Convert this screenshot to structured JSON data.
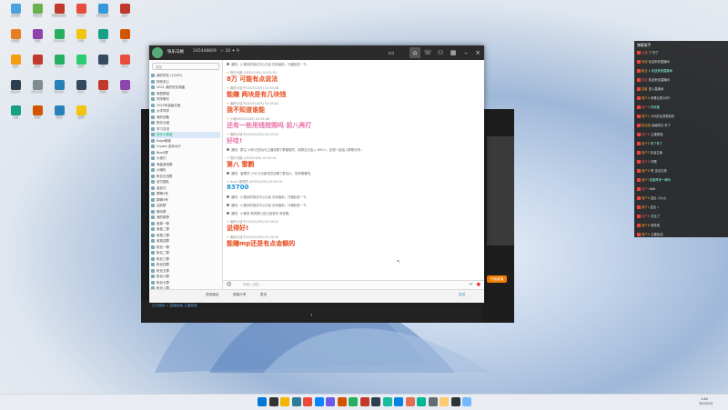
{
  "desktop": {
    "icons": [
      {
        "label": "此电脑",
        "color": "#4aa3df"
      },
      {
        "label": "回收站",
        "color": "#6ab04c"
      },
      {
        "label": "网易云音乐",
        "color": "#c0392b"
      },
      {
        "label": "Edge",
        "color": "#e74c3c"
      },
      {
        "label": "控制面板",
        "color": "#3498db"
      },
      {
        "label": "软件",
        "color": "#c0392b"
      },
      {
        "label": "小程序",
        "color": "#e67e22"
      },
      {
        "label": "文档",
        "color": "#8e44ad"
      },
      {
        "label": "Chrome",
        "color": "#27ae60"
      },
      {
        "label": "OBS",
        "color": "#f1c40f"
      },
      {
        "label": "网易",
        "color": "#16a085"
      },
      {
        "label": "QQ",
        "color": "#d35400"
      },
      {
        "label": "音乐",
        "color": "#f39c12"
      },
      {
        "label": "游戏",
        "color": "#c0392b"
      },
      {
        "label": "Excel",
        "color": "#27ae60"
      },
      {
        "label": "微信",
        "color": "#2ecc71"
      },
      {
        "label": "YY",
        "color": "#34495e"
      },
      {
        "label": "WPS",
        "color": "#e74c3c"
      },
      {
        "label": "Steam",
        "color": "#2c3e50"
      },
      {
        "label": "Blender",
        "color": "#7f8c8d"
      },
      {
        "label": "Steam",
        "color": "#2980b9"
      },
      {
        "label": "Epic",
        "color": "#34495e"
      },
      {
        "label": "网游",
        "color": "#c0392b"
      },
      {
        "label": "视频",
        "color": "#8e44ad"
      },
      {
        "label": "工具",
        "color": "#16a085"
      },
      {
        "label": "剪映",
        "color": "#d35400"
      },
      {
        "label": "腾讯",
        "color": "#2980b9"
      },
      {
        "label": "酷狗",
        "color": "#f1c40f"
      }
    ]
  },
  "qq": {
    "username": "快乐马格",
    "uid": "245448809",
    "status": "☆ 20 ✦ 9",
    "search_placeholder": "搜索",
    "contacts": [
      "我的好友 (22/90)",
      "特别关心",
      "2021 我的好友收藏",
      "家庭群组",
      "同学聊天",
      "2022年高级分组",
      "大学同学",
      "我的设备",
      "阳光大团",
      "学习交流",
      "快乐小群组",
      "Edge频道",
      "Crypto 游戏大厅",
      "BooG群",
      "大佬们",
      "海量游戏群",
      "小喇叭",
      "粉丝交流群",
      "官方团队",
      "朋友们",
      "群聊4号",
      "群聊5号",
      "活跃群",
      "聊天群",
      "我的推荐",
      "家族一群",
      "家族二群",
      "家族三群",
      "家族四群",
      "粉丝一群",
      "粉丝二群",
      "粉丝三群",
      "粉丝四群",
      "粉丝五群",
      "粉丝六群",
      "粉丝七群",
      "粉丝八群",
      "粉丝九群"
    ],
    "messages": [
      {
        "kind": "sys",
        "text": "通知：小程序的测试中心已经 在你面前，仔细检查一下。"
      },
      {
        "kind": "msg",
        "hdr": "快乐马格 (2025/1/05)  01:53:33",
        "text": "8万 可能有点说法",
        "color": "#e54b1d"
      },
      {
        "kind": "msg",
        "hdr": "南阳小娃子(2025/1/05)  01:53:38",
        "text": "能赚 两块是有几块钱",
        "color": "#e54b1d"
      },
      {
        "kind": "msg",
        "hdr": "南阳小娃子(2025/1/05)  01:53:42",
        "text": "我不知道谁能",
        "color": "#e54b1d"
      },
      {
        "kind": "msg",
        "hdr": "小明(2025/1/05)  01:53:48",
        "text": "还有一些用钱按照吗 前八再打",
        "color": "#e86fa7"
      },
      {
        "kind": "msg",
        "hdr": "南阳小娃子(2025/1/05)  01:53:52",
        "text": "好哇!",
        "color": "#e86fa7"
      },
      {
        "kind": "sys",
        "text": "通知：群主 小明 已成功为主播设置了群管理员，新群友已加入 800人，赶快一起加入群聊天吧..."
      },
      {
        "kind": "msg",
        "hdr": "快乐马格 (2025/1/05)  01:54:01",
        "text": "第八 雪鹳",
        "color": "#e54b1d"
      },
      {
        "kind": "sys",
        "text": "通知：管理员 小马 已为新成员设置了群名片，快来看看吧。"
      },
      {
        "kind": "msg",
        "hdr": "Xuan 管理员 (2025/1/05)  01:54:10",
        "text": "83700",
        "color": "#1a8fd8"
      },
      {
        "kind": "sys",
        "text": "通知：小程序的测试中心已经 在你面前，仔细检查一下。"
      },
      {
        "kind": "sys",
        "text": "通知：小程序的测试中心已经 在你面前，仔细检查一下。"
      },
      {
        "kind": "sys",
        "text": "通知：小程序 新的群公告已经发布 请查看。"
      },
      {
        "kind": "msg",
        "hdr": "南阳小娃子(2025/1/05)  01:54:21",
        "text": "说得好!",
        "color": "#e54b1d"
      },
      {
        "kind": "msg",
        "hdr": "南阳小娃子(2025/1/05)  01:54:30",
        "text": "能赚mp还是有点金额的",
        "color": "#e54b1d"
      }
    ],
    "input_placeholder": "请输入消息...",
    "bottom": {
      "a": "语音通话",
      "b": "屏幕分享",
      "c": "更多",
      "send": "发送"
    }
  },
  "video": {
    "caption": "正在播放 > 直播画面 主播频道",
    "center_label": "7",
    "orange_tag": "开始直播"
  },
  "live_panel": {
    "title": "弹幕助手",
    "rows": [
      {
        "name": "主播",
        "text": "了 好了"
      },
      {
        "name": "系统",
        "text": "欢迎来到直播间"
      },
      {
        "name": "粉丝",
        "text": "1 欢迎来到直播间"
      },
      {
        "name": "欢迎",
        "text": "欢迎来到直播间"
      },
      {
        "name": "游客",
        "text": "进入直播间"
      },
      {
        "name": "用户A",
        "text": "来看比赛大吗?"
      },
      {
        "name": "用户B",
        "text": "好厉害"
      },
      {
        "name": "用户C",
        "text": "今天的比赛很精彩"
      },
      {
        "name": "粉丝团",
        "text": "高级粉丝 来了"
      },
      {
        "name": "用户D",
        "text": "主播很强"
      },
      {
        "name": "用户E",
        "text": "来了来了"
      },
      {
        "name": "用户F",
        "text": "加油主播"
      },
      {
        "name": "用户G",
        "text": "好看"
      },
      {
        "name": "用户H",
        "text": "赞 送出礼物"
      },
      {
        "name": "用户I",
        "text": "还能再来一局吗"
      },
      {
        "name": "用户J",
        "text": "666"
      },
      {
        "name": "用户K",
        "text": "送出 小心心"
      },
      {
        "name": "用户L",
        "text": "送出 ✓"
      },
      {
        "name": "用户M",
        "text": "关注了"
      },
      {
        "name": "用户N",
        "text": "哈哈哈"
      },
      {
        "name": "用户O",
        "text": "主播加油"
      }
    ]
  },
  "taskbar": {
    "icons": [
      "#0078d4",
      "#333",
      "#f4b400",
      "#2d7d9a",
      "#e74c3c",
      "#0a84ff",
      "#6c5ce7",
      "#d35400",
      "#27ae60",
      "#c0392b",
      "#2c3e50",
      "#1abc9c",
      "#0984e3",
      "#e17055",
      "#00b894",
      "#636e72",
      "#fdcb6e",
      "#2d3436",
      "#74b9ff"
    ],
    "time": "1:46",
    "date": "2025/1/5"
  }
}
